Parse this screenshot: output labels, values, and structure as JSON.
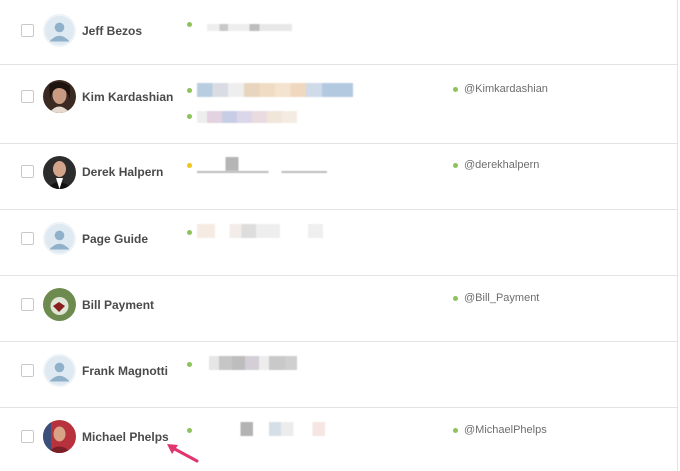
{
  "contacts": [
    {
      "name": "Jeff Bezos",
      "handle": "",
      "status_color": "#8dc35a"
    },
    {
      "name": "Kim Kardashian",
      "handle": "@Kimkardashian",
      "status_color": "#8dc35a"
    },
    {
      "name": "Derek Halpern",
      "handle": "@derekhalpern",
      "status_color": "#f0c419"
    },
    {
      "name": "Page Guide",
      "handle": "",
      "status_color": "#8dc35a"
    },
    {
      "name": "Bill Payment",
      "handle": "@Bill_Payment",
      "status_color": "#8dc35a"
    },
    {
      "name": "Frank Magnotti",
      "handle": "",
      "status_color": "#8dc35a"
    },
    {
      "name": "Michael Phelps",
      "handle": "@MichaelPhelps",
      "status_color": "#8dc35a"
    }
  ],
  "colors": {
    "handle_dot": "#8dc35a",
    "annotation_arrow": "#e0356e",
    "row_divider": "#e3e3e3"
  },
  "icons": {
    "default_avatar": "person-silhouette-icon",
    "arrow": "annotation-arrow-icon"
  }
}
